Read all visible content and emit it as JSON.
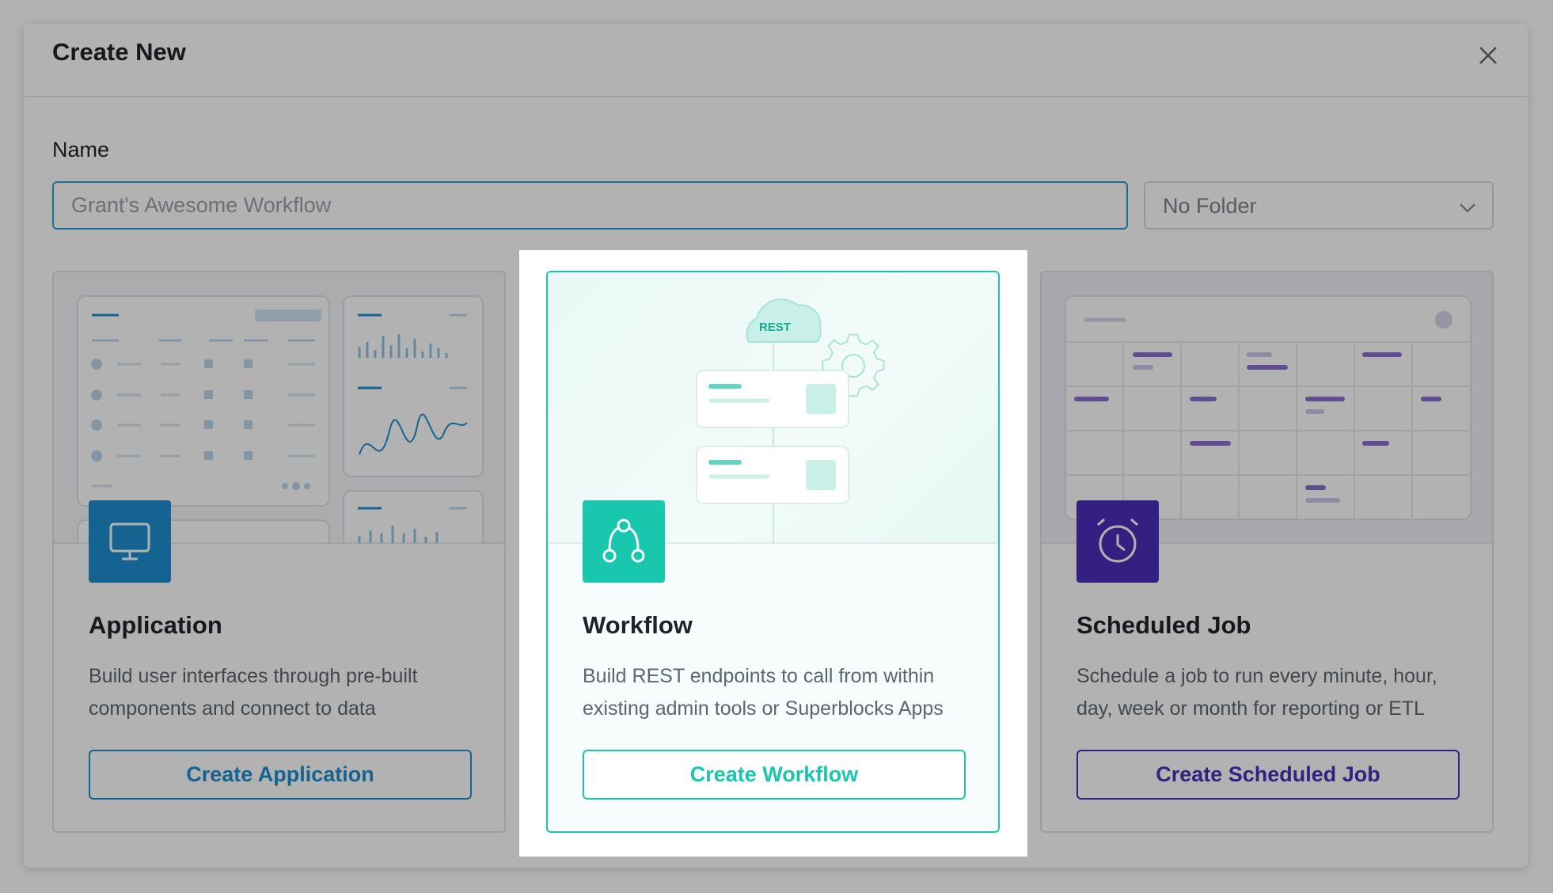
{
  "modal": {
    "title": "Create New"
  },
  "form": {
    "name_label": "Name",
    "name_placeholder": "Grant's Awesome Workflow",
    "folder_value": "No Folder"
  },
  "cards": {
    "application": {
      "title": "Application",
      "description": "Build user interfaces through pre-built components and connect to data",
      "button": "Create Application",
      "accent": "#1d8ed0",
      "icon": "monitor-icon"
    },
    "workflow": {
      "title": "Workflow",
      "description": "Build REST endpoints to call from within existing admin tools or Superblocks Apps",
      "button": "Create Workflow",
      "accent": "#19c7ae",
      "icon": "workflow-nodes-icon",
      "art_label": "REST"
    },
    "scheduled_job": {
      "title": "Scheduled Job",
      "description": "Schedule a job to run every minute, hour, day, week or month for reporting or ETL",
      "button": "Create Scheduled Job",
      "accent": "#4a2fb8",
      "icon": "alarm-clock-icon"
    }
  },
  "colors": {
    "backdrop": "#b3b3b3",
    "primary_input_border": "#2c9ed6"
  }
}
